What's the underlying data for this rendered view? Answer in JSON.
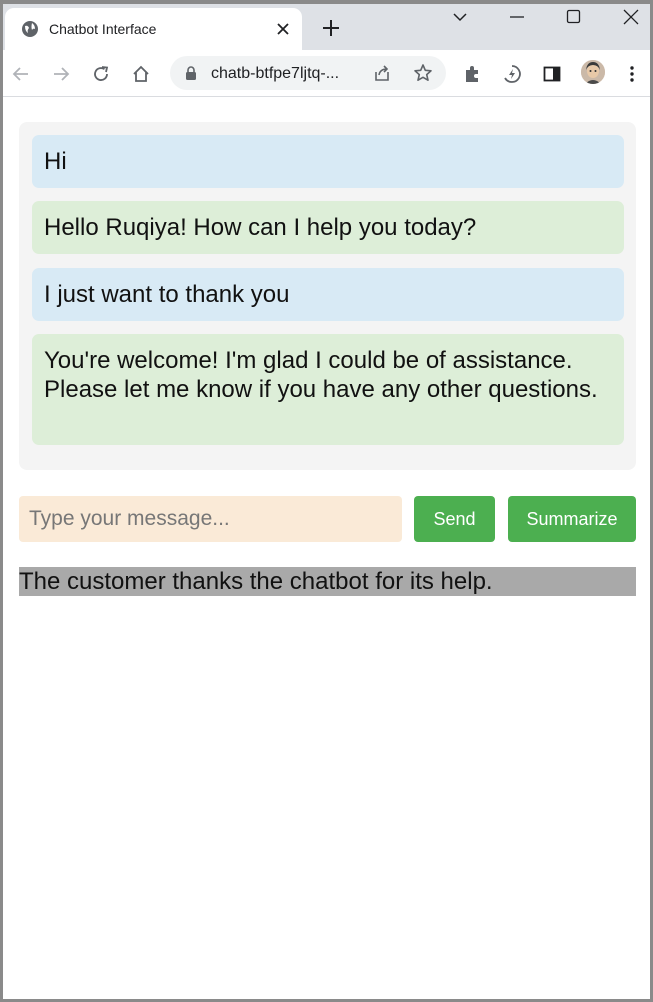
{
  "browser": {
    "tab_title": "Chatbot Interface",
    "url": "chatb-btfpe7ljtq-..."
  },
  "chat": {
    "messages": [
      {
        "role": "user",
        "text": "Hi"
      },
      {
        "role": "bot",
        "text": "Hello Ruqiya! How can I help you today?"
      },
      {
        "role": "user",
        "text": "I just want to thank you"
      },
      {
        "role": "bot",
        "text": "You're welcome! I'm glad I could be of assistance. Please let me know if you have any other questions."
      }
    ]
  },
  "composer": {
    "placeholder": "Type your message...",
    "send_label": "Send",
    "summarize_label": "Summarize"
  },
  "summary": {
    "text": "The customer thanks the chatbot for its help."
  },
  "colors": {
    "user_bubble": "#d8eaf5",
    "bot_bubble": "#ddeed8",
    "button": "#4caf50",
    "input_bg": "#faead7",
    "summary_bg": "#a9a9a9"
  }
}
